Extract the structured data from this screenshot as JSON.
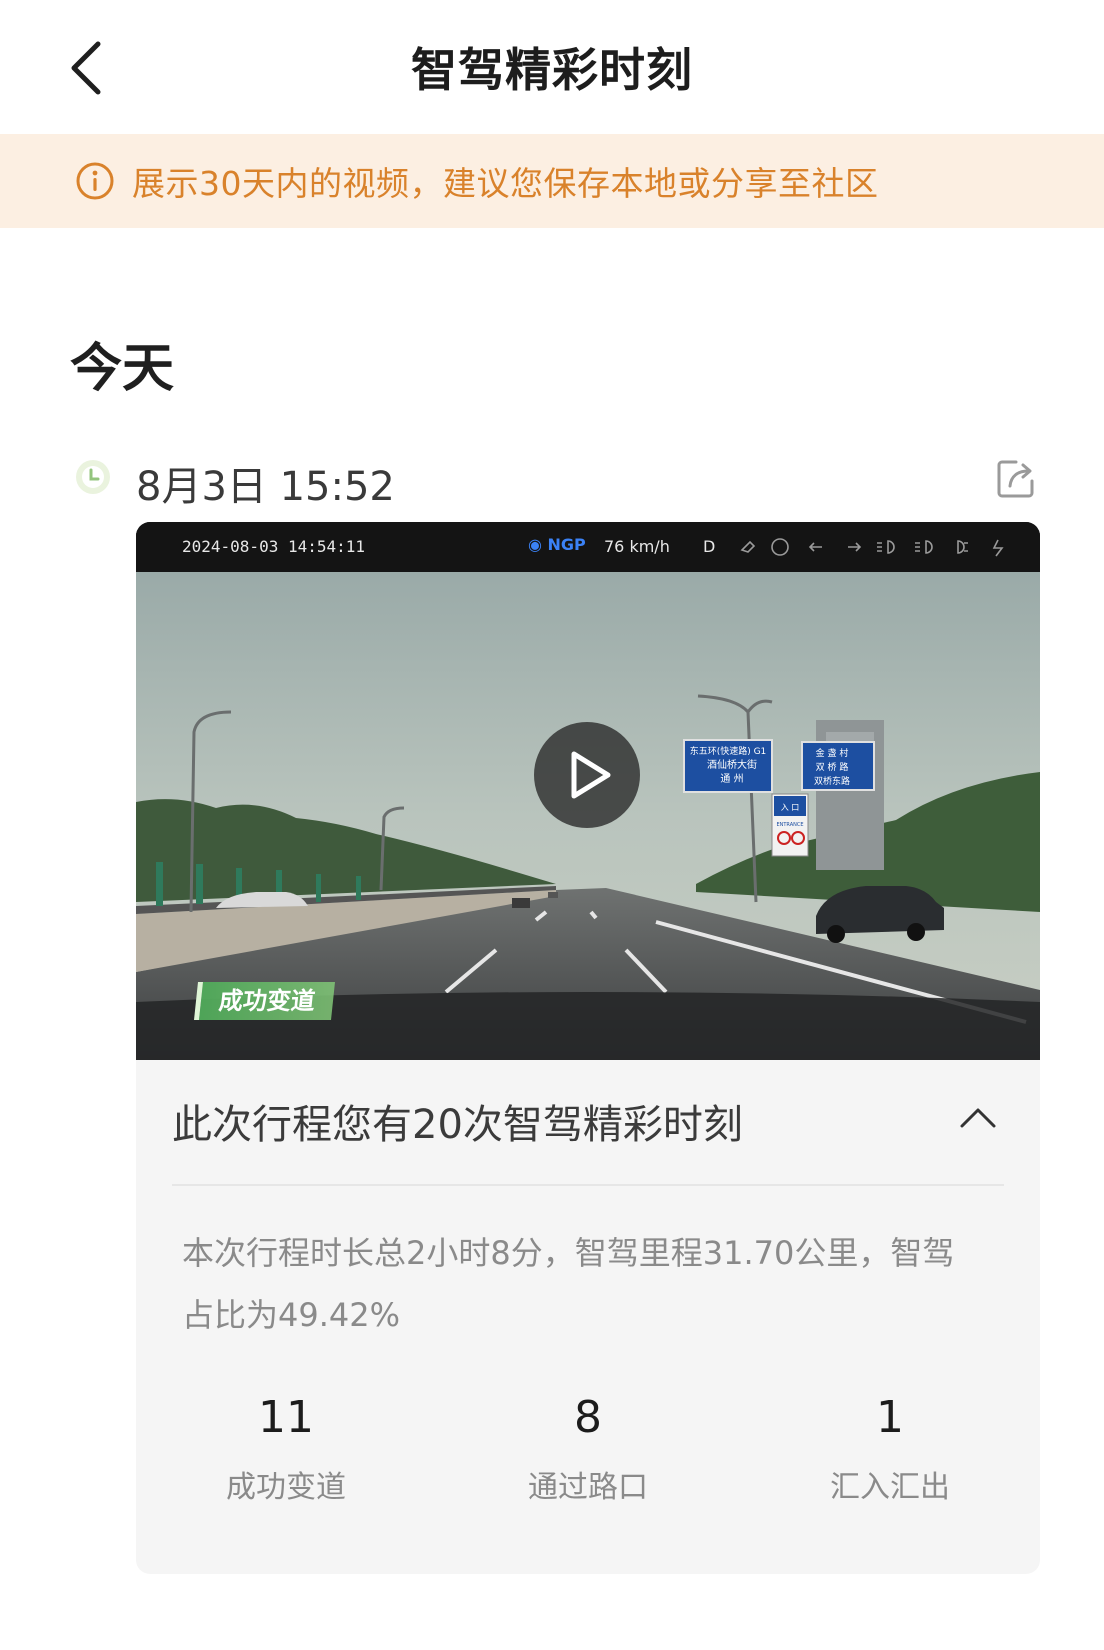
{
  "header": {
    "title": "智驾精彩时刻",
    "back_icon": "chevron-left-icon"
  },
  "notice": {
    "icon": "info-circle-icon",
    "text": "展示30天内的视频，建议您保存本地或分享至社区",
    "color": "#d9822b",
    "background": "#fcefe2"
  },
  "section": {
    "title": "今天"
  },
  "entry": {
    "time": "8月3日 15:52",
    "clock_icon": "clock-icon",
    "share_icon": "share-icon",
    "video": {
      "overlay_date": "2024-08-03    14:54:11",
      "ngp_label": "NGP",
      "speed": "76   km/h",
      "gear": "D",
      "tag": "成功变道",
      "play_icon": "play-icon",
      "sign_left_line1": "东五环(快速路) G1",
      "sign_left_line2": "酒仙桥大街",
      "sign_left_line3": "通 州",
      "sign_right_line1": "金 盏 村",
      "sign_right_line2": "双 桥 路",
      "sign_right_line3": "双桥东路",
      "sign_small_line1": "入 口",
      "sign_small_line2": "ENTRANCE"
    },
    "summary": {
      "title": "此次行程您有20次智驾精彩时刻",
      "collapse_icon": "chevron-up-icon",
      "description": "本次行程时长总2小时8分，智驾里程31.70公里，智驾占比为49.42%",
      "stats": [
        {
          "value": "11",
          "label": "成功变道"
        },
        {
          "value": "8",
          "label": "通过路口"
        },
        {
          "value": "1",
          "label": "汇入汇出"
        }
      ]
    }
  }
}
